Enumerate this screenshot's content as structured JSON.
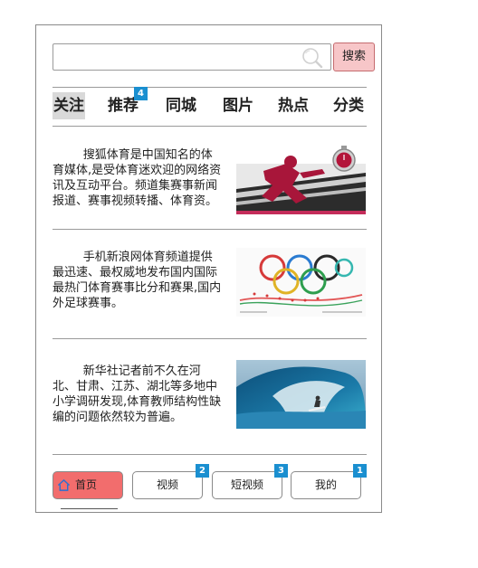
{
  "search": {
    "placeholder": "",
    "value": "",
    "button_label": "搜索"
  },
  "tabs": [
    {
      "label": "关注",
      "active": true
    },
    {
      "label": "推荐",
      "badge": "4"
    },
    {
      "label": "同城"
    },
    {
      "label": "图片"
    },
    {
      "label": "热点"
    },
    {
      "label": "分类"
    }
  ],
  "articles": [
    {
      "text": "搜狐体育是中国知名的体育媒体,是受体育迷欢迎的网络资讯及互动平台。频道集赛事新闻报道、赛事视频转播、体育资。",
      "image": "sprinter-stopwatch"
    },
    {
      "text": "手机新浪网体育频道提供最迅速、最权威地发布国内国际最热门体育赛事比分和赛果,国内外足球赛事。",
      "image": "olympic-rings-athletes"
    },
    {
      "text": "新华社记者前不久在河北、甘肃、江苏、湖北等多地中小学调研发现,体育教师结构性缺编的问题依然较为普遍。",
      "image": "surfer-wave"
    }
  ],
  "bottom_nav": [
    {
      "label": "首页",
      "icon": "home-icon",
      "active": true,
      "color": "#f26d6d"
    },
    {
      "label": "视频",
      "badge": "2"
    },
    {
      "label": "短视频",
      "badge": "3"
    },
    {
      "label": "我的",
      "badge": "1"
    }
  ],
  "colors": {
    "badge": "#1a8fd0",
    "search_button": "#f7c6c8",
    "home_active": "#f26d6d"
  }
}
